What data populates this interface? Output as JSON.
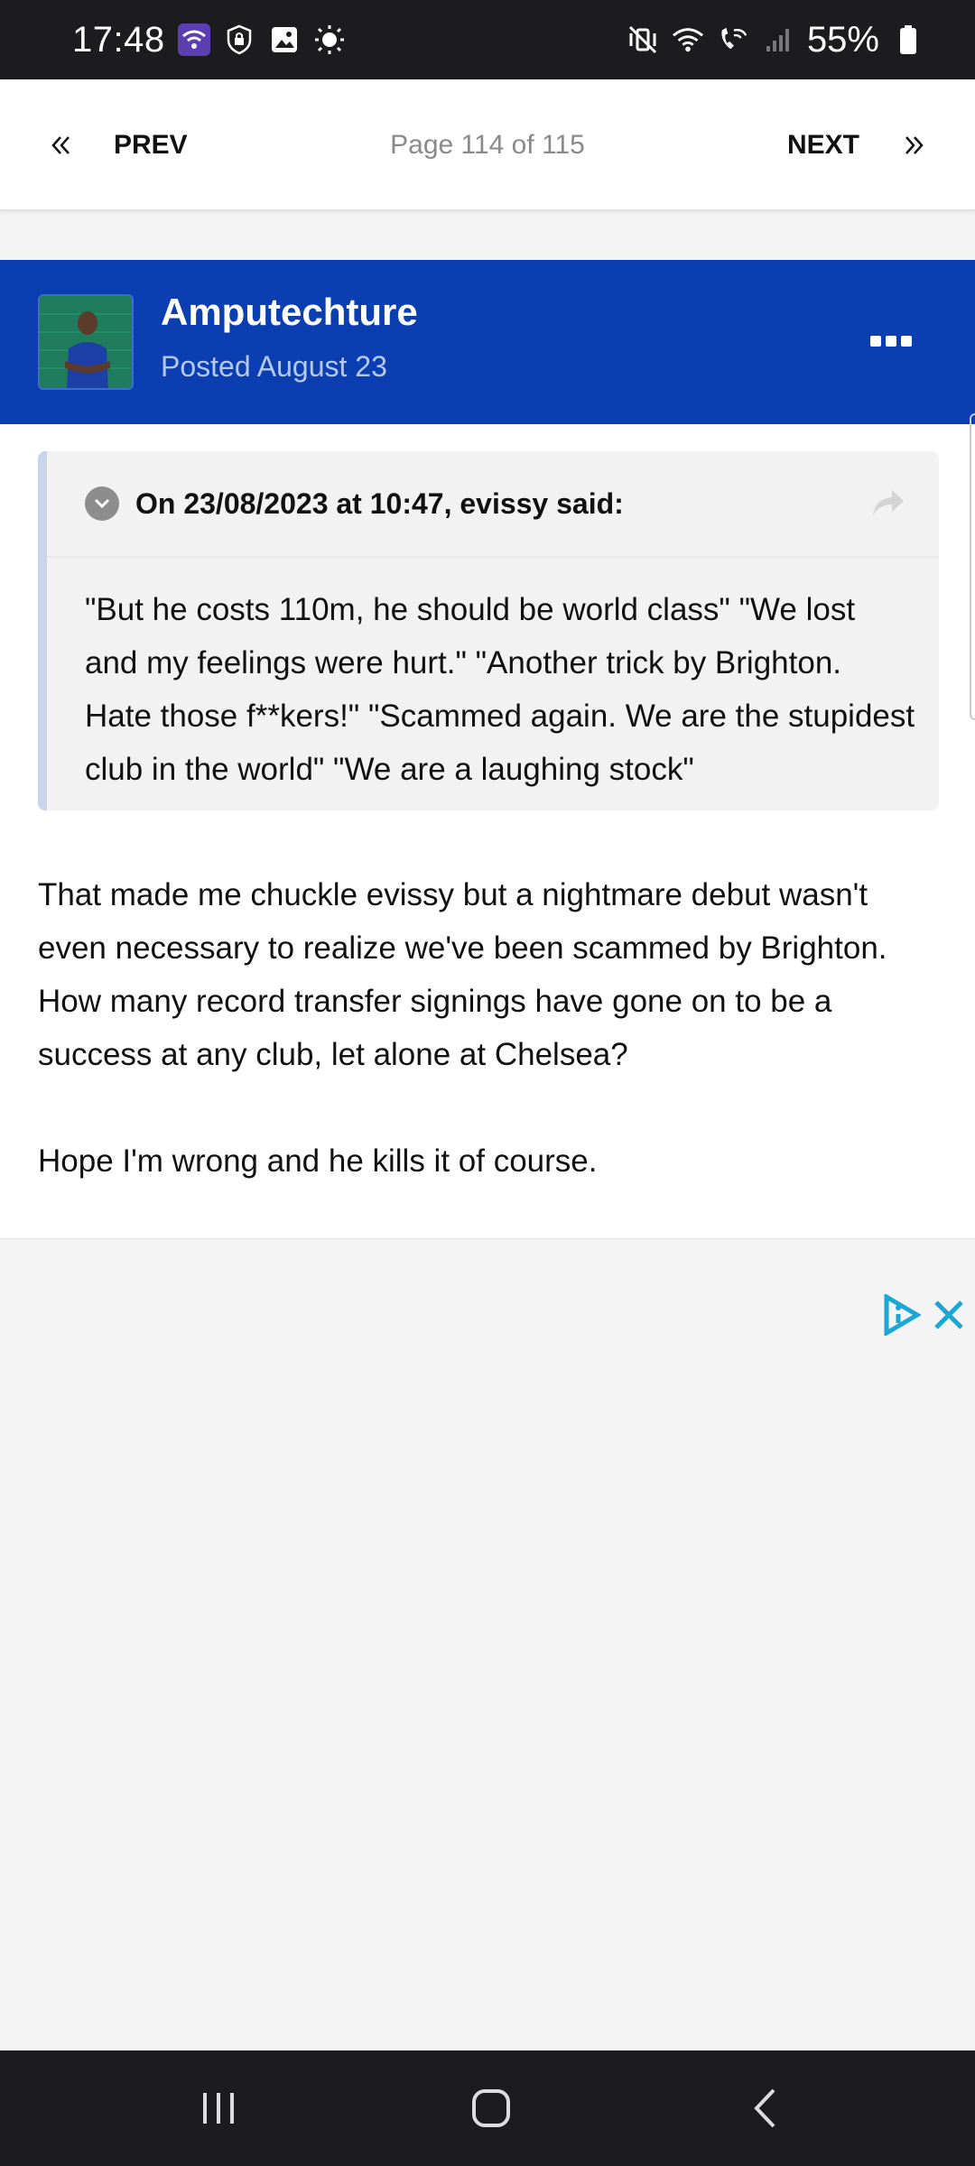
{
  "status_bar": {
    "time": "17:48",
    "battery": "55%",
    "left_icons": [
      "wifi-hotspot-icon",
      "vpn-shield-icon",
      "gallery-icon",
      "brightness-icon"
    ],
    "right_icons": [
      "vibrate-mute-icon",
      "wifi-icon",
      "wifi-calling-icon",
      "signal-icon",
      "battery-icon"
    ]
  },
  "pagination": {
    "prev_label": "PREV",
    "next_label": "NEXT",
    "page_text": "Page 114 of 115"
  },
  "post": {
    "author": "Amputechture",
    "date": "Posted August 23",
    "header_color": "#0b3fb1",
    "quote": {
      "citation": "On 23/08/2023 at 10:47, evissy said:",
      "text": "\"But he costs 110m, he should be world class\" \"We lost and my feelings were hurt.\" \"Another trick by Brighton. Hate those f**kers!\" \"Scammed again. We are the stupidest club in the world\" \"We are a laughing stock\""
    },
    "paragraphs": [
      "That made me chuckle evissy but a nightmare debut wasn't even necessary to realize we've been scammed by Brighton. How many record transfer signings have gone on to be a success at any club, let alone at Chelsea?",
      "Hope I'm wrong and he kills it of course."
    ]
  },
  "ad": {
    "choices_icon": "adchoices-icon",
    "close_icon": "close-icon",
    "accent_color": "#1aa7d6"
  },
  "nav_bar": {
    "icons": [
      "recent-apps-icon",
      "home-icon",
      "back-icon"
    ]
  }
}
